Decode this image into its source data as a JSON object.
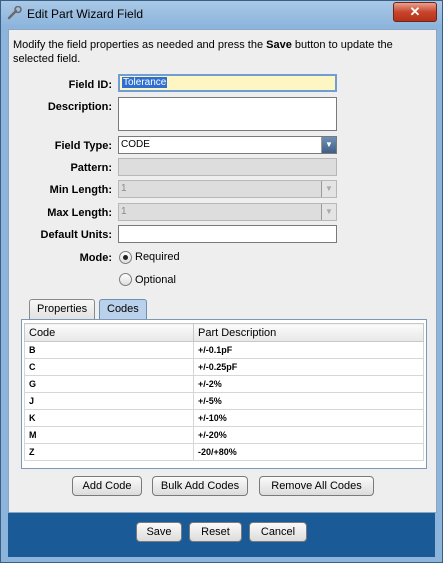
{
  "window": {
    "title": "Edit Part Wizard Field",
    "close_glyph": "✕",
    "icon": "wrench-icon"
  },
  "intro_text": "Modify the field properties as needed and press the Save button to update the selected field.",
  "form": {
    "field_id": {
      "label": "Field ID:",
      "value": "Tolerance"
    },
    "description": {
      "label": "Description:",
      "value": ""
    },
    "field_type": {
      "label": "Field Type:",
      "value": "CODE"
    },
    "pattern": {
      "label": "Pattern:",
      "value": ""
    },
    "min_length": {
      "label": "Min Length:",
      "value": "1"
    },
    "max_length": {
      "label": "Max Length:",
      "value": "1"
    },
    "default_units": {
      "label": "Default Units:",
      "value": ""
    },
    "mode": {
      "label": "Mode:",
      "options": [
        {
          "label": "Required",
          "selected": true
        },
        {
          "label": "Optional",
          "selected": false
        }
      ]
    }
  },
  "tabs": [
    {
      "label": "Properties",
      "active": false
    },
    {
      "label": "Codes",
      "active": true
    }
  ],
  "codes_table": {
    "columns": [
      "Code",
      "Part Description"
    ],
    "rows": [
      [
        "B",
        "+/-0.1pF"
      ],
      [
        "C",
        "+/-0.25pF"
      ],
      [
        "G",
        "+/-2%"
      ],
      [
        "J",
        "+/-5%"
      ],
      [
        "K",
        "+/-10%"
      ],
      [
        "M",
        "+/-20%"
      ],
      [
        "Z",
        "-20/+80%"
      ]
    ]
  },
  "code_buttons": {
    "add": "Add Code",
    "bulk_add": "Bulk Add Codes",
    "remove_all": "Remove All Codes"
  },
  "footer_buttons": {
    "save": "Save",
    "reset": "Reset",
    "cancel": "Cancel"
  },
  "colors": {
    "footer": "#1a5a96",
    "focus_field": "#fdf6c3",
    "selection": "#2f6fd0"
  }
}
